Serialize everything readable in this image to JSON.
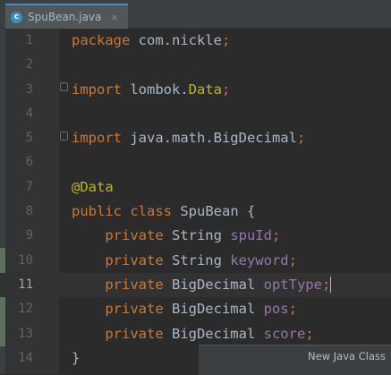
{
  "tab": {
    "filename": "SpuBean.java",
    "icon_letter": "c",
    "close_glyph": "×"
  },
  "code_lines": [
    {
      "num": "1",
      "tokens": [
        {
          "t": "package ",
          "c": "kw"
        },
        {
          "t": "com.nickle",
          "c": "cls"
        },
        {
          "t": ";",
          "c": "kw"
        }
      ]
    },
    {
      "num": "2",
      "tokens": []
    },
    {
      "num": "3",
      "tokens": [
        {
          "t": "import ",
          "c": "kw"
        },
        {
          "t": "lombok.",
          "c": "cls"
        },
        {
          "t": "Data",
          "c": "ann"
        },
        {
          "t": ";",
          "c": "kw"
        }
      ]
    },
    {
      "num": "4",
      "tokens": []
    },
    {
      "num": "5",
      "tokens": [
        {
          "t": "import ",
          "c": "kw"
        },
        {
          "t": "java.math.BigDecimal",
          "c": "cls"
        },
        {
          "t": ";",
          "c": "kw"
        }
      ]
    },
    {
      "num": "6",
      "tokens": []
    },
    {
      "num": "7",
      "tokens": [
        {
          "t": "@Data",
          "c": "ann"
        }
      ]
    },
    {
      "num": "8",
      "tokens": [
        {
          "t": "public class ",
          "c": "kw"
        },
        {
          "t": "SpuBean {",
          "c": "cls"
        }
      ]
    },
    {
      "num": "9",
      "tokens": [
        {
          "t": "    private ",
          "c": "kw"
        },
        {
          "t": "String ",
          "c": "cls"
        },
        {
          "t": "spuId",
          "c": "fld"
        },
        {
          "t": ";",
          "c": "kw"
        }
      ]
    },
    {
      "num": "10",
      "tokens": [
        {
          "t": "    private ",
          "c": "kw"
        },
        {
          "t": "String ",
          "c": "cls"
        },
        {
          "t": "keyword",
          "c": "fld"
        },
        {
          "t": ";",
          "c": "kw"
        }
      ]
    },
    {
      "num": "11",
      "current": true,
      "tokens": [
        {
          "t": "    private ",
          "c": "kw"
        },
        {
          "t": "BigDecimal ",
          "c": "cls"
        },
        {
          "t": "optType",
          "c": "fld"
        },
        {
          "t": ";",
          "c": "kw"
        }
      ]
    },
    {
      "num": "12",
      "tokens": [
        {
          "t": "    private ",
          "c": "kw"
        },
        {
          "t": "BigDecimal ",
          "c": "cls"
        },
        {
          "t": "pos",
          "c": "fld"
        },
        {
          "t": ";",
          "c": "kw"
        }
      ]
    },
    {
      "num": "13",
      "tokens": [
        {
          "t": "    private ",
          "c": "kw"
        },
        {
          "t": "BigDecimal ",
          "c": "cls"
        },
        {
          "t": "score",
          "c": "fld"
        },
        {
          "t": ";",
          "c": "kw"
        }
      ]
    },
    {
      "num": "14",
      "tokens": [
        {
          "t": "}",
          "c": "cls"
        }
      ]
    }
  ],
  "popup": {
    "title": "New Java Class"
  },
  "colors": {
    "keyword": "#cc7832",
    "annotation": "#bbb529",
    "field": "#9876aa",
    "text": "#a9b7c6",
    "background": "#2b2b2b",
    "tab_accent": "#4a88c7"
  }
}
